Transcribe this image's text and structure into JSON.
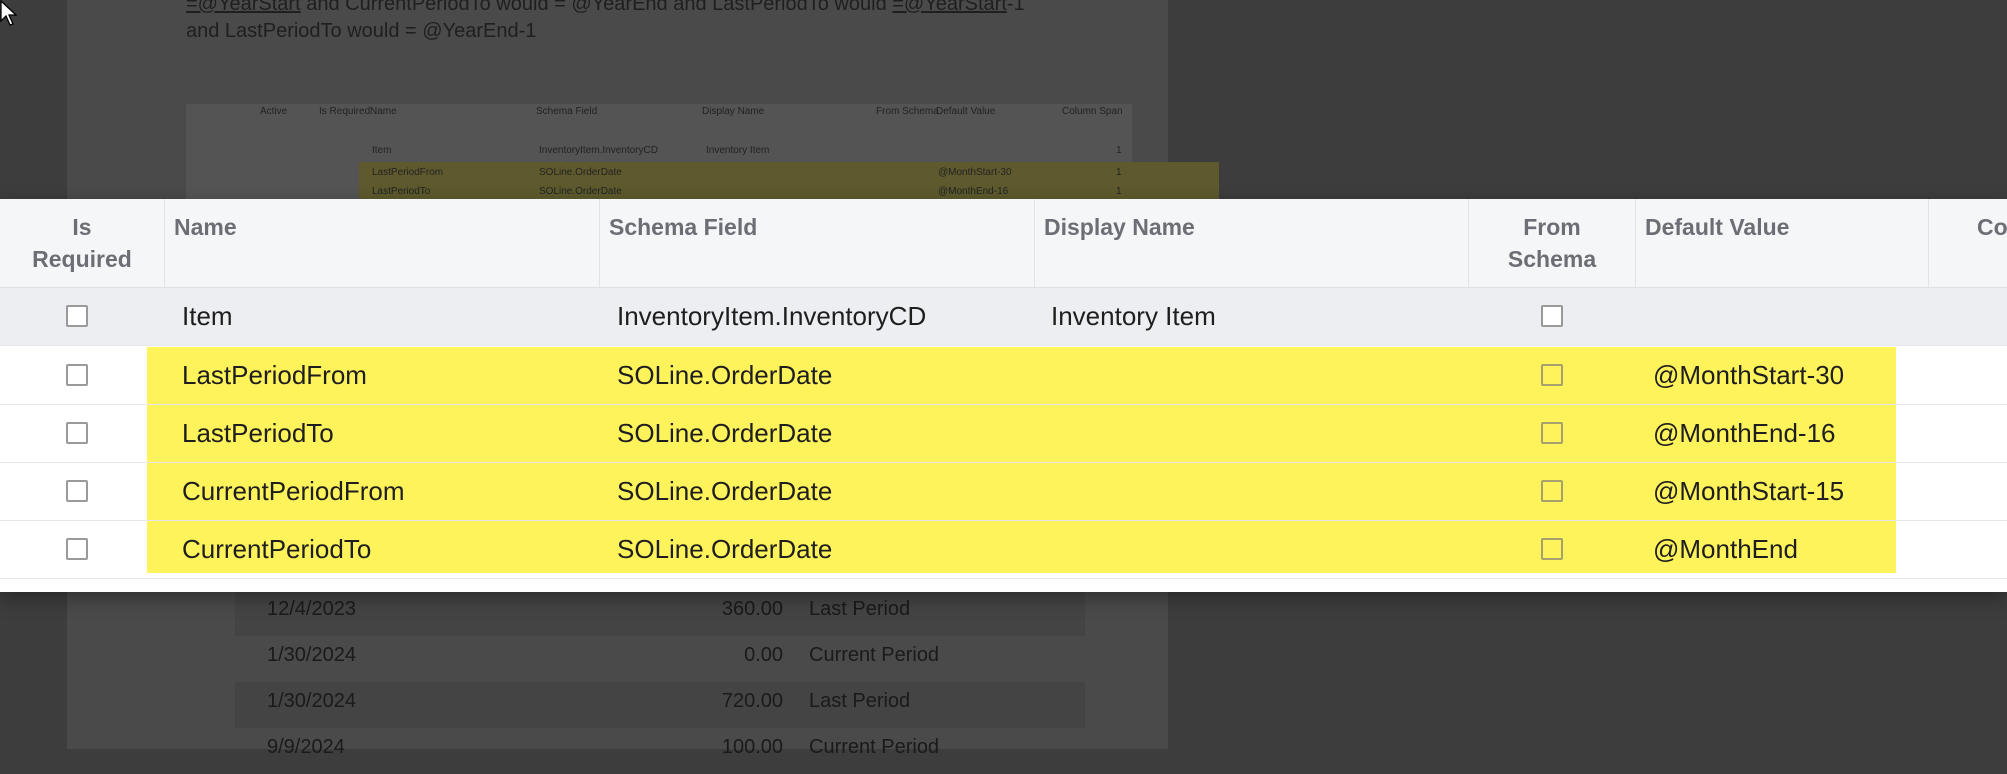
{
  "background": {
    "doc_line1": {
      "a": "=@YearStart",
      "b": " and CurrentPeriodTo would = @YearEnd and LastPeriodTo would ",
      "c": "=@YearStart",
      "d": "-1"
    },
    "doc_line2": "and LastPeriodTo would = @YearEnd-1",
    "mini_table": {
      "headers": [
        "Active",
        "Is Required",
        "Name",
        "Schema Field",
        "Display Name",
        "From Schema",
        "Default Value",
        "Column Span"
      ],
      "rows": [
        {
          "name": "Item",
          "schema": "InventoryItem.InventoryCD",
          "display": "Inventory Item",
          "default": "",
          "span": "1"
        },
        {
          "name": "LastPeriodFrom",
          "schema": "SOLine.OrderDate",
          "display": "",
          "default": "@MonthStart-30",
          "span": "1"
        },
        {
          "name": "LastPeriodTo",
          "schema": "SOLine.OrderDate",
          "display": "",
          "default": "@MonthEnd-16",
          "span": "1"
        }
      ]
    },
    "result_rows": [
      {
        "date": "12/4/2023",
        "value": "360.00",
        "period": "Last Period"
      },
      {
        "date": "1/30/2024",
        "value": "0.00",
        "period": "Current Period"
      },
      {
        "date": "1/30/2024",
        "value": "720.00",
        "period": "Last Period"
      },
      {
        "date": "9/9/2024",
        "value": "100.00",
        "period": "Current Period"
      }
    ]
  },
  "table": {
    "headers": {
      "is_required_1": "Is",
      "is_required_2": "Required",
      "name": "Name",
      "schema_field": "Schema Field",
      "display_name": "Display Name",
      "from_schema_1": "From",
      "from_schema_2": "Schema",
      "default_value": "Default Value",
      "column_span": "Co"
    },
    "rows": [
      {
        "name": "Item",
        "schema_field": "InventoryItem.InventoryCD",
        "display_name": "Inventory Item",
        "default_value": ""
      },
      {
        "name": "LastPeriodFrom",
        "schema_field": "SOLine.OrderDate",
        "display_name": "",
        "default_value": "@MonthStart-30"
      },
      {
        "name": "LastPeriodTo",
        "schema_field": "SOLine.OrderDate",
        "display_name": "",
        "default_value": "@MonthEnd-16"
      },
      {
        "name": "CurrentPeriodFrom",
        "schema_field": "SOLine.OrderDate",
        "display_name": "",
        "default_value": "@MonthStart-15"
      },
      {
        "name": "CurrentPeriodTo",
        "schema_field": "SOLine.OrderDate",
        "display_name": "",
        "default_value": "@MonthEnd"
      }
    ]
  },
  "colors": {
    "highlight": "#fff35c",
    "header_bg": "#f5f6f8",
    "header_text": "#6b6f75"
  },
  "icons": [
    "cursor-arrow-icon",
    "checkbox-icon"
  ]
}
